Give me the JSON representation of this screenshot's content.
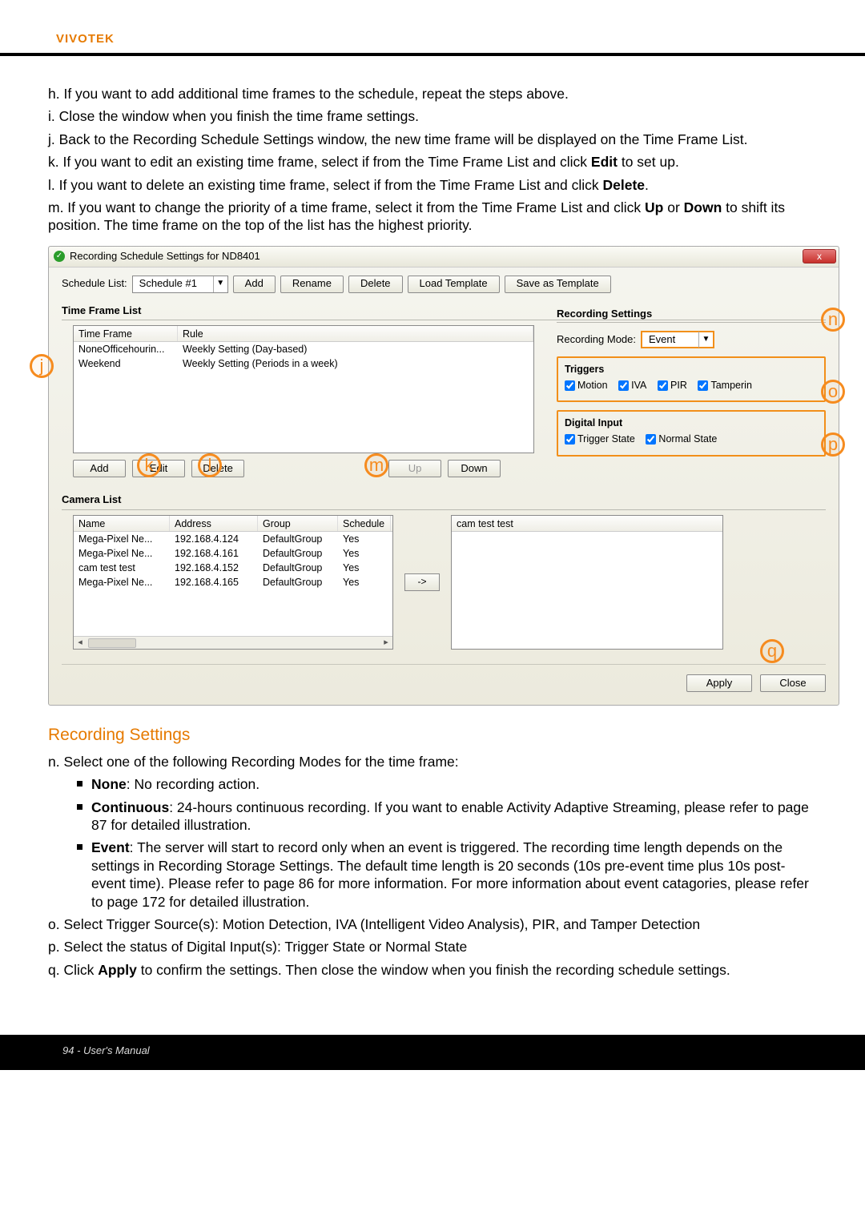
{
  "brand": "VIVOTEK",
  "instructions": {
    "h": "h. If you want to add additional time frames to the schedule, repeat the steps above.",
    "i": "i. Close the window when you finish the time frame settings.",
    "j": "j. Back to the Recording Schedule Settings window, the new time frame will be displayed on the Time Frame List.",
    "k_pre": "k. If you want to edit an existing time frame, select if from the Time Frame List and click ",
    "k_b": "Edit",
    "k_post": " to set up.",
    "l_pre": "l. If you want to delete an existing time frame, select if from the Time Frame List and click ",
    "l_b": "Delete",
    "l_post": ".",
    "m_pre": "m. If you want to change the priority of a time frame, select it from the Time Frame List and click ",
    "m_b1": "Up",
    "m_mid": " or ",
    "m_b2": "Down",
    "m_post": " to shift its position. The time frame on the top of the list has the highest priority."
  },
  "dialog": {
    "title": "Recording Schedule Settings for ND8401",
    "close_x": "x",
    "schedule_list_label": "Schedule List:",
    "schedule_selected": "Schedule #1",
    "btn_add": "Add",
    "btn_rename": "Rename",
    "btn_delete": "Delete",
    "btn_load_template": "Load Template",
    "btn_save_template": "Save as Template",
    "tflist_title": "Time Frame List",
    "tf_head_c1": "Time Frame",
    "tf_head_c2": "Rule",
    "tf_rows": [
      {
        "name": "NoneOfficehourin...",
        "rule": "Weekly Setting (Day-based)"
      },
      {
        "name": "Weekend",
        "rule": "Weekly Setting (Periods in a week)"
      }
    ],
    "btns_under_list": {
      "add": "Add",
      "edit": "Edit",
      "delete": "Delete",
      "up": "Up",
      "down": "Down"
    },
    "recording_settings": {
      "title": "Recording Settings",
      "mode_label": "Recording Mode:",
      "mode_value": "Event",
      "triggers": {
        "title": "Triggers",
        "motion": "Motion",
        "iva": "IVA",
        "pir": "PIR",
        "tamper": "Tamperin"
      },
      "digital_input": {
        "title": "Digital Input",
        "trigger_state": "Trigger State",
        "normal_state": "Normal State"
      }
    },
    "camera_list": {
      "title": "Camera List",
      "head": {
        "name": "Name",
        "address": "Address",
        "group": "Group",
        "schedule": "Schedule"
      },
      "rows": [
        {
          "name": "Mega-Pixel Ne...",
          "address": "192.168.4.124",
          "group": "DefaultGroup",
          "schedule": "Yes"
        },
        {
          "name": "Mega-Pixel Ne...",
          "address": "192.168.4.161",
          "group": "DefaultGroup",
          "schedule": "Yes"
        },
        {
          "name": "cam test test",
          "address": "192.168.4.152",
          "group": "DefaultGroup",
          "schedule": "Yes"
        },
        {
          "name": "Mega-Pixel Ne...",
          "address": "192.168.4.165",
          "group": "DefaultGroup",
          "schedule": "Yes"
        }
      ],
      "move_btn": "->",
      "selected_head": "cam test test"
    },
    "apply": "Apply",
    "close": "Close"
  },
  "annot": {
    "j": "j",
    "k": "k",
    "l": "l",
    "m": "m",
    "n": "n",
    "o": "o",
    "p": "p",
    "q": "q"
  },
  "recording_settings_section": {
    "title": "Recording Settings",
    "n": "n. Select one of the following Recording Modes for the time frame:",
    "none_b": "None",
    "none_txt": ": No recording action.",
    "cont_b": "Continuous",
    "cont_txt": ": 24-hours continuous recording. If you want to enable Activity Adaptive Streaming, please refer to page 87 for detailed illustration.",
    "event_b": "Event",
    "event_txt": ": The server will start to record only when an event is triggered. The recording time length depends on the settings in Recording Storage Settings. The default time length is 20 seconds (10s pre-event time plus 10s post-event time). Please refer to page 86 for more information. For more information about event catagories, please refer to page 172 for detailed illustration.",
    "o": "o. Select Trigger Source(s): Motion Detection, IVA (Intelligent Video Analysis), PIR, and Tamper Detection",
    "p": "p. Select the status of Digital Input(s): Trigger State or Normal State",
    "q_pre": "q. Click ",
    "q_b": "Apply",
    "q_post": " to confirm the settings. Then close the window when you finish the recording schedule settings."
  },
  "footer": "94 - User's Manual"
}
